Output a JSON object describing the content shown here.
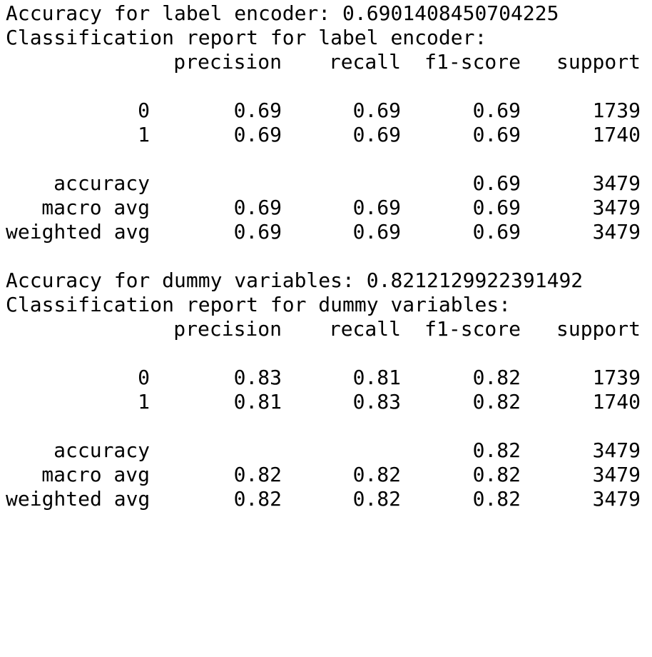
{
  "reports": [
    {
      "accuracy_line": "Accuracy for label encoder: 0.6901408450704225",
      "report_title": "Classification report for label encoder:",
      "headers": [
        "precision",
        "recall",
        "f1-score",
        "support"
      ],
      "class_rows": [
        {
          "label": "0",
          "precision": "0.69",
          "recall": "0.69",
          "f1": "0.69",
          "support": "1739"
        },
        {
          "label": "1",
          "precision": "0.69",
          "recall": "0.69",
          "f1": "0.69",
          "support": "1740"
        }
      ],
      "summary_rows": [
        {
          "label": "accuracy",
          "precision": "",
          "recall": "",
          "f1": "0.69",
          "support": "3479"
        },
        {
          "label": "macro avg",
          "precision": "0.69",
          "recall": "0.69",
          "f1": "0.69",
          "support": "3479"
        },
        {
          "label": "weighted avg",
          "precision": "0.69",
          "recall": "0.69",
          "f1": "0.69",
          "support": "3479"
        }
      ]
    },
    {
      "accuracy_line": "Accuracy for dummy variables: 0.8212129922391492",
      "report_title": "Classification report for dummy variables:",
      "headers": [
        "precision",
        "recall",
        "f1-score",
        "support"
      ],
      "class_rows": [
        {
          "label": "0",
          "precision": "0.83",
          "recall": "0.81",
          "f1": "0.82",
          "support": "1739"
        },
        {
          "label": "1",
          "precision": "0.81",
          "recall": "0.83",
          "f1": "0.82",
          "support": "1740"
        }
      ],
      "summary_rows": [
        {
          "label": "accuracy",
          "precision": "",
          "recall": "",
          "f1": "0.82",
          "support": "3479"
        },
        {
          "label": "macro avg",
          "precision": "0.82",
          "recall": "0.82",
          "f1": "0.82",
          "support": "3479"
        },
        {
          "label": "weighted avg",
          "precision": "0.82",
          "recall": "0.82",
          "f1": "0.82",
          "support": "3479"
        }
      ]
    }
  ]
}
